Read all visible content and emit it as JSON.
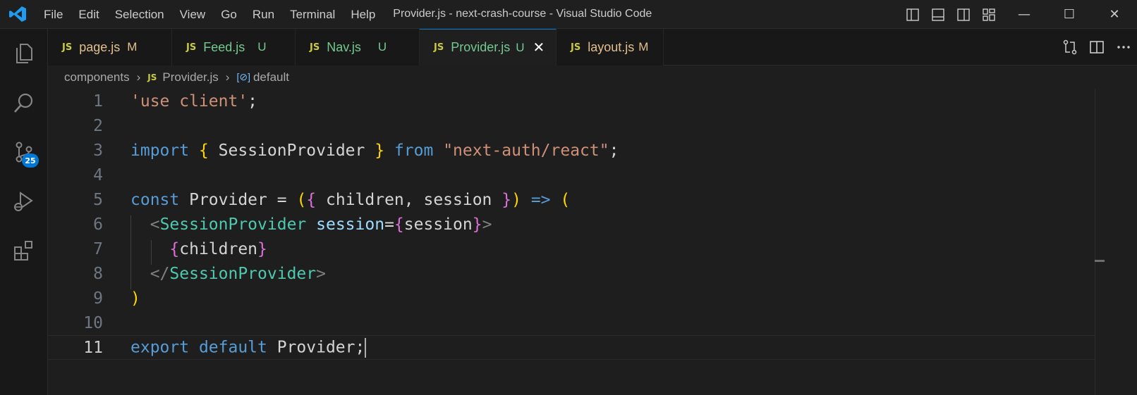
{
  "window": {
    "title": "Provider.js - next-crash-course - Visual Studio Code",
    "accent": "#0078d4"
  },
  "menu": [
    "File",
    "Edit",
    "Selection",
    "View",
    "Go",
    "Run",
    "Terminal",
    "Help"
  ],
  "controls": {
    "minimize": "—",
    "maximize": "☐",
    "close": "✕"
  },
  "activity": {
    "items": [
      "explorer-icon",
      "search-icon",
      "source-control-icon",
      "run-debug-icon",
      "extensions-icon"
    ],
    "source_control_badge": "25"
  },
  "tabs": [
    {
      "label": "page.js",
      "status": "M",
      "active": false,
      "color": "#e2c08d"
    },
    {
      "label": "Feed.js",
      "status": "U",
      "active": false,
      "color": "#73c991"
    },
    {
      "label": "Nav.js",
      "status": "U",
      "active": false,
      "color": "#73c991"
    },
    {
      "label": "Provider.js",
      "status": "U",
      "active": true,
      "color": "#73c991"
    },
    {
      "label": "layout.js",
      "status": "M",
      "active": false,
      "color": "#e2c08d"
    }
  ],
  "file_icon_label": "JS",
  "close_glyph": "✕",
  "breadcrumb": {
    "folder": "components",
    "file": "Provider.js",
    "symbol": "default"
  },
  "editor": {
    "current_line": 11,
    "line_numbers": [
      "1",
      "2",
      "3",
      "4",
      "5",
      "6",
      "7",
      "8",
      "9",
      "10",
      "11"
    ],
    "code": {
      "l1": {
        "str": "'use client'",
        "semi": ";"
      },
      "l3": {
        "kw": "import",
        "ob": "{",
        "name": " SessionProvider ",
        "cb": "}",
        "from": "from",
        "str": "\"next-auth/react\"",
        "semi": ";"
      },
      "l5": {
        "kw": "const",
        "name": " Provider ",
        "eq": "= ",
        "op": "(",
        "ob": "{",
        "params": " children, session ",
        "cb": "}",
        "cp": ")",
        "arrow": " => ",
        "open": "("
      },
      "l6": {
        "lt": "<",
        "tag": "SessionProvider",
        "attr": " session",
        "eq": "=",
        "ob": "{",
        "val": "session",
        "cb": "}",
        "gt": ">"
      },
      "l7": {
        "ob": "{",
        "val": "children",
        "cb": "}"
      },
      "l8": {
        "lt": "</",
        "tag": "SessionProvider",
        "gt": ">"
      },
      "l9": {
        "close": ")"
      },
      "l11": {
        "kw1": "export",
        "kw2": " default",
        "name": " Provider",
        "semi": ";"
      }
    }
  }
}
